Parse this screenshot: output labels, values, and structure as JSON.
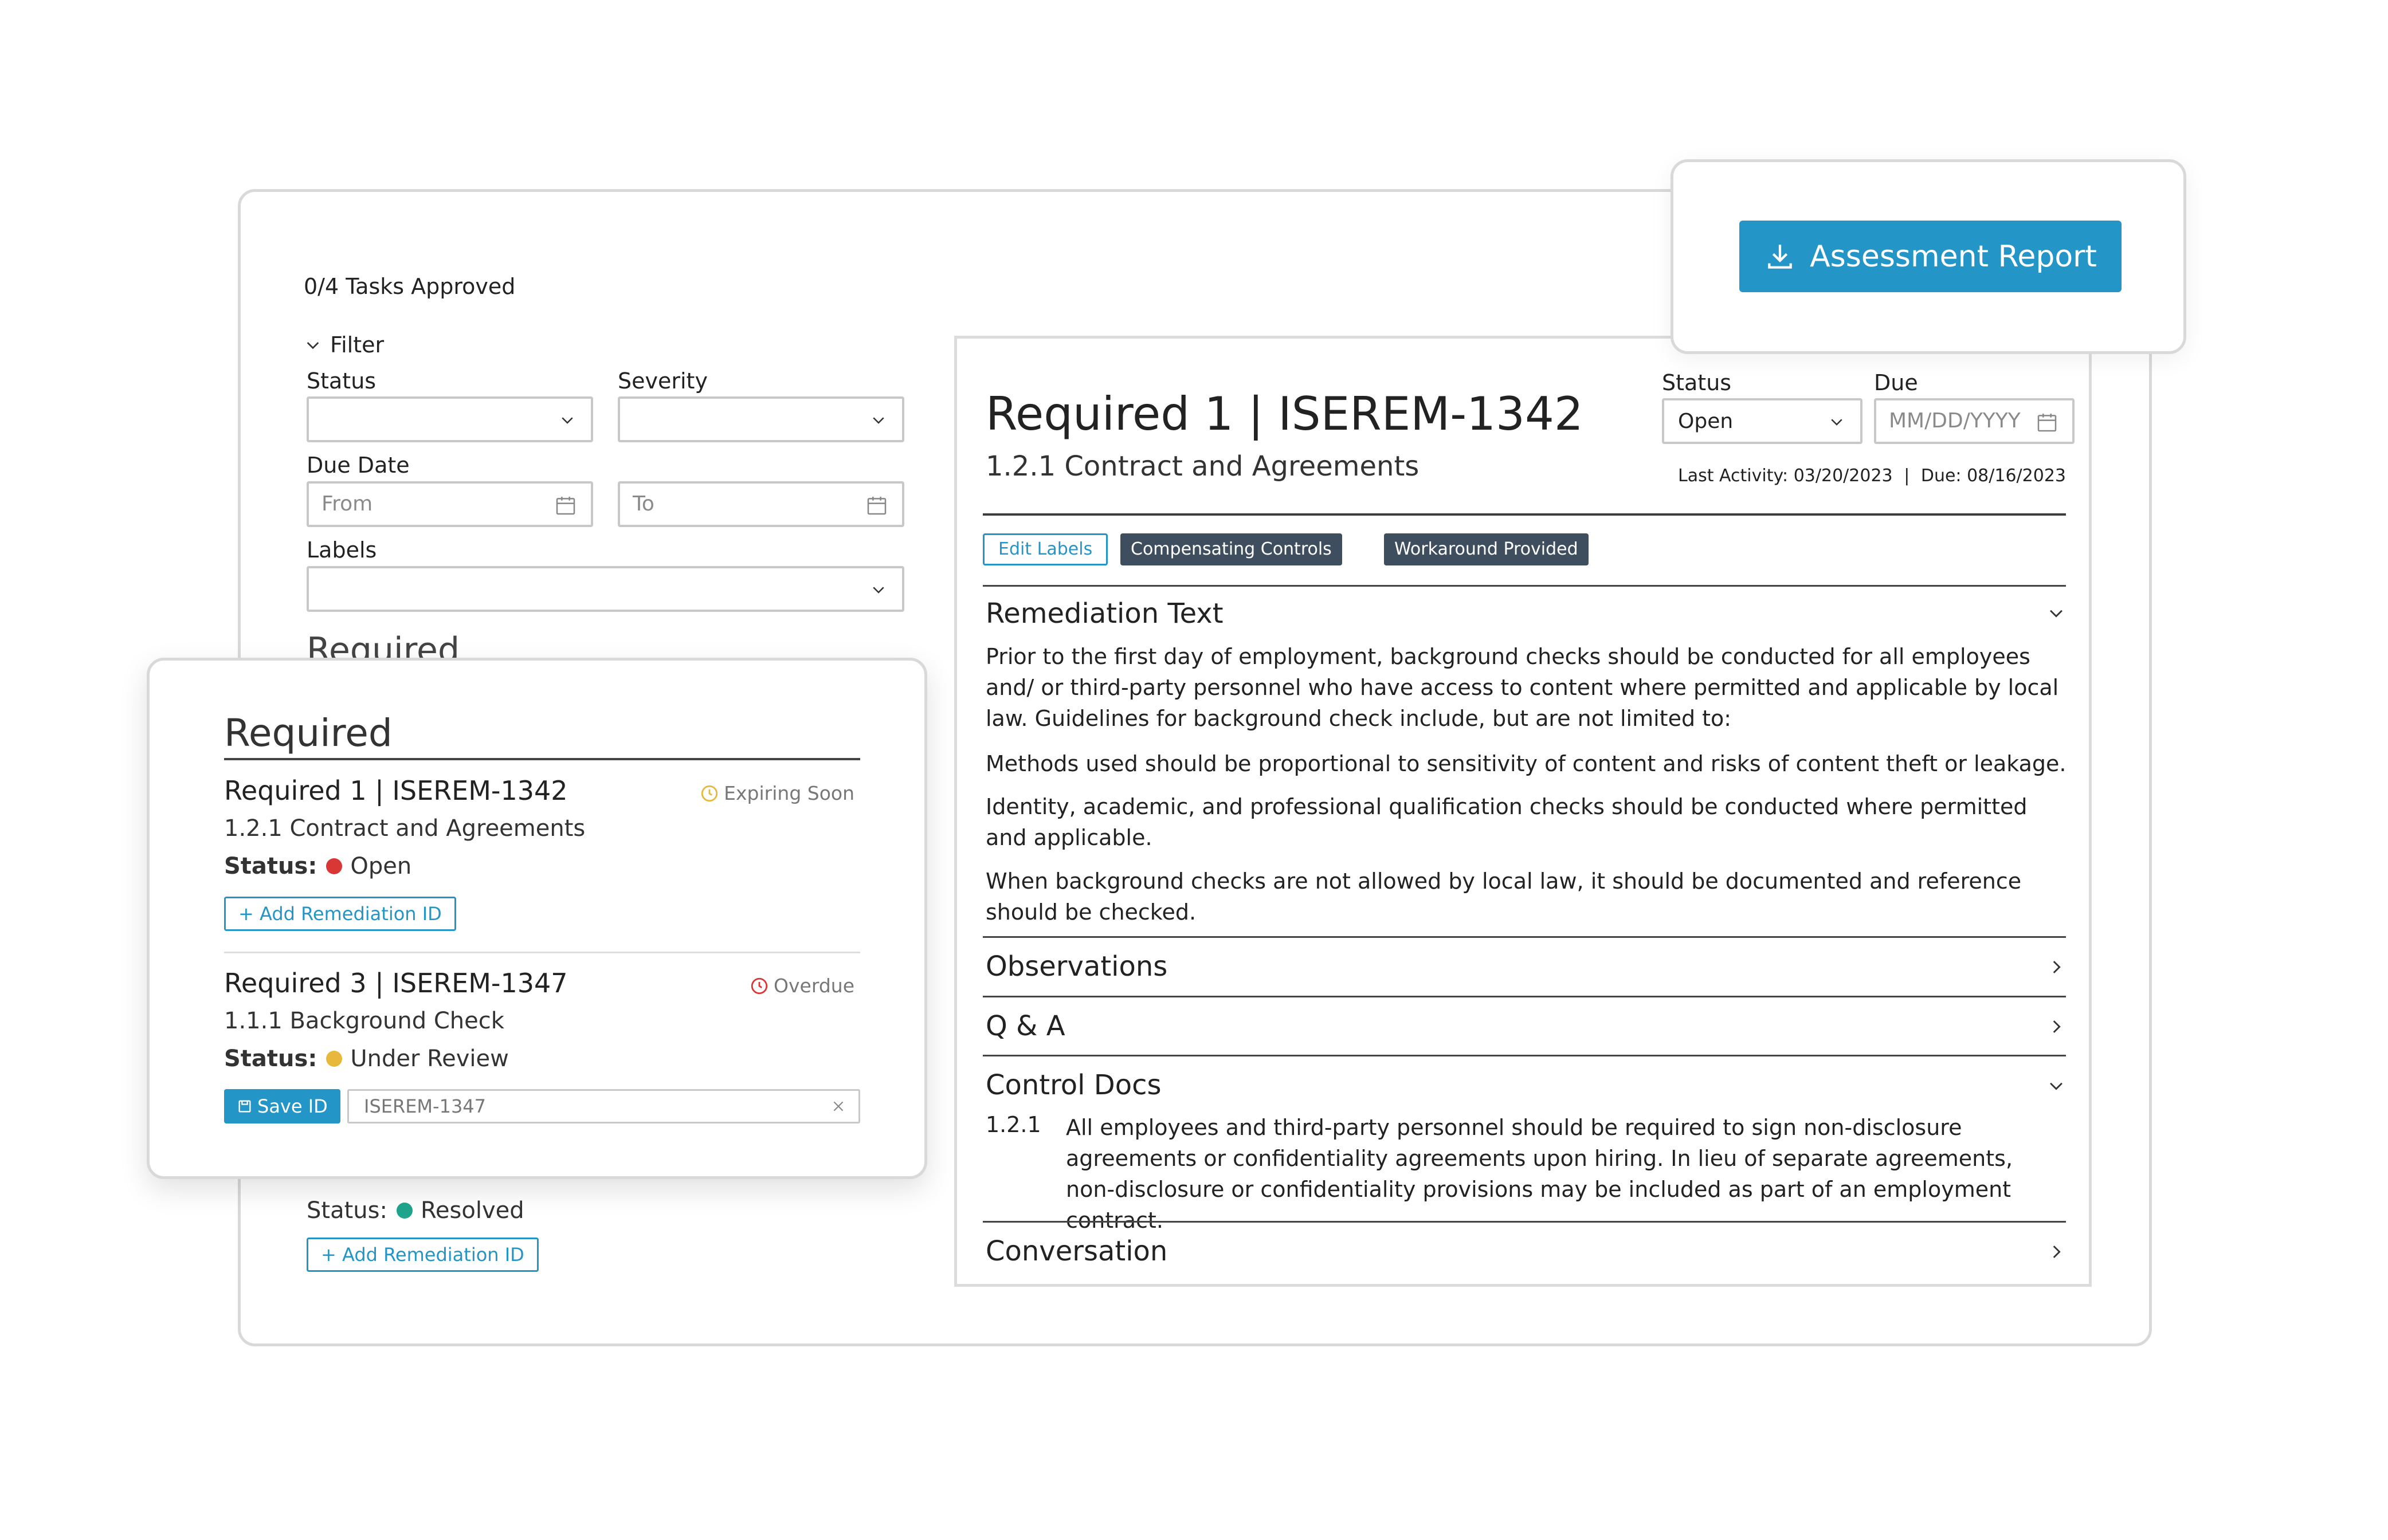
{
  "header": {
    "tasks_approved": "0/4 Tasks Approved",
    "report_button": "Assessment Report"
  },
  "filter": {
    "title": "Filter",
    "status_label": "Status",
    "severity_label": "Severity",
    "due_date_label": "Due Date",
    "from_placeholder": "From",
    "to_placeholder": "To",
    "labels_label": "Labels"
  },
  "background_list": {
    "section_title_partial": "Required",
    "status_label": "Status:",
    "status_value": "Resolved",
    "add_button": "+ Add Remediation ID"
  },
  "required_card": {
    "title": "Required",
    "items": [
      {
        "title": "Required 1 | ISEREM-1342",
        "badge": "Expiring Soon",
        "subtitle": "1.2.1 Contract and Agreements",
        "status_label": "Status:",
        "status_value": "Open",
        "action": "+ Add Remediation ID"
      },
      {
        "title": "Required 3 | ISEREM-1347",
        "badge": "Overdue",
        "subtitle": "1.1.1 Background Check",
        "status_label": "Status:",
        "status_value": "Under Review",
        "save_button": "Save ID",
        "input_value": "ISEREM-1347"
      }
    ]
  },
  "detail": {
    "title": "Required 1 | ISEREM-1342",
    "subtitle": "1.2.1 Contract and Agreements",
    "status_label": "Status",
    "status_value": "Open",
    "due_label": "Due",
    "due_placeholder": "MM/DD/YYYY",
    "last_activity_label": "Last Activity:",
    "last_activity_value": "03/20/2023",
    "due_meta_label": "Due:",
    "due_meta_value": "08/16/2023",
    "edit_labels": "Edit Labels",
    "tags": [
      "Compensating Controls",
      "Workaround Provided"
    ],
    "sections": {
      "remediation": "Remediation Text",
      "observations": "Observations",
      "qa": "Q & A",
      "control_docs": "Control Docs",
      "conversation": "Conversation"
    },
    "remediation_paragraphs": [
      "Prior to the first day of employment, background checks should be conducted for all employees and/ or third-party personnel who have access to content where permitted and applicable by local law. Guidelines for background check include, but are not limited to:",
      "Methods used should be proportional to sensitivity of content and risks of content theft or leakage.",
      "Identity, academic, and professional qualification checks should be conducted where permitted and applicable.",
      "When background checks are not allowed by local law, it should be documented and reference should be checked."
    ],
    "control_doc": {
      "number": "1.2.1",
      "text": "All employees and third-party personnel should be required to sign non-disclosure agreements or confidentiality agreements upon hiring. In lieu of separate agreements, non-disclosure or confidentiality provisions may be included as part of an employment contract."
    }
  },
  "colors": {
    "accent": "#2395c6",
    "tag_dark": "#3f4e5f",
    "status_open": "#d93636",
    "status_review": "#e8b83c",
    "status_resolved": "#1fa58c",
    "expiring": "#e8b83c",
    "overdue": "#d93636"
  }
}
